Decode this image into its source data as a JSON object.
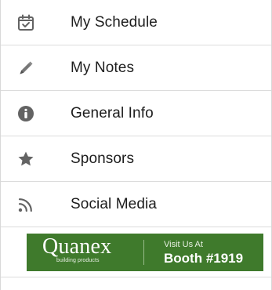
{
  "menu": {
    "items": [
      {
        "label": "My Schedule",
        "icon": "calendar-check-icon"
      },
      {
        "label": "My Notes",
        "icon": "pencil-icon"
      },
      {
        "label": "General Info",
        "icon": "info-circle-icon"
      },
      {
        "label": "Sponsors",
        "icon": "star-icon"
      },
      {
        "label": "Social Media",
        "icon": "rss-feed-icon"
      }
    ]
  },
  "banner": {
    "brand": "Quanex",
    "tagline": "building products",
    "visit": "Visit Us At",
    "booth": "Booth #1919",
    "background": "#3f7a2c"
  },
  "colors": {
    "icon": "#636363",
    "text": "#1d1d1d",
    "divider": "#dcdcdc"
  }
}
